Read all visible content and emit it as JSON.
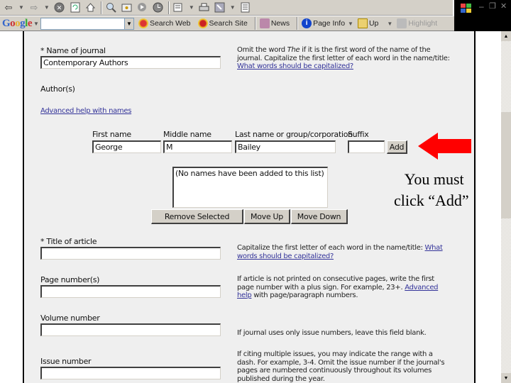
{
  "browser": {
    "toolbar_icons": [
      "back-icon",
      "forward-icon",
      "stop-icon",
      "refresh-icon",
      "home-icon",
      "search-icon",
      "favorites-icon",
      "media-icon",
      "history-icon",
      "mail-icon",
      "print-icon",
      "edit-icon",
      "discuss-icon"
    ],
    "google_bar": {
      "logo": "Google",
      "search_value": "",
      "buttons": {
        "search_web": "Search Web",
        "search_site": "Search Site",
        "news": "News",
        "page_info": "Page Info",
        "up": "Up",
        "highlight": "Highlight"
      }
    },
    "window_controls": {
      "minimize": "–",
      "restore": "❐",
      "close": "✕"
    }
  },
  "form": {
    "journal": {
      "label": "* Name of journal",
      "value": "Contemporary Authors",
      "help_prefix": "Omit the word ",
      "help_italic": "The",
      "help_suffix": " if it is the first word of the name of the journal. Capitalize the first letter of each word in the name/title: ",
      "help_link": "What words should be capitalized?"
    },
    "authors": {
      "label": "Author(s)",
      "help_link": "Advanced help with names",
      "columns": {
        "first": "First name",
        "middle": "Middle name",
        "last": "Last name or group/corporation",
        "suffix": "Suffix"
      },
      "values": {
        "first": "George",
        "middle": "M",
        "last": "Bailey",
        "suffix": ""
      },
      "add_button": "Add",
      "list_placeholder": "(No names have been added to this list)",
      "remove_button": "Remove Selected",
      "move_up_button": "Move Up",
      "move_down_button": "Move Down"
    },
    "title": {
      "label": "* Title of article",
      "value": "",
      "help_text": "Capitalize the first letter of each word in the name/title: ",
      "help_link": "What words should be capitalized?"
    },
    "pages": {
      "label": "Page number(s)",
      "value": "",
      "help_text": "If article is not printed on consecutive pages, write the first page number with a plus sign. For example, 23+. ",
      "help_link": "Advanced help",
      "help_suffix": " with page/paragraph numbers."
    },
    "volume": {
      "label": "Volume number",
      "value": "",
      "help_text": "If journal uses only issue numbers, leave this field blank."
    },
    "issue": {
      "label": "Issue number",
      "value": "",
      "help_text": "If citing multiple issues, you may indicate the range with a dash. For example, 3-4. Omit the issue number if the journal's pages are numbered continuously throughout its volumes published during the year."
    }
  },
  "annotation": {
    "line1": "You must",
    "line2": "click “Add”",
    "arrow_color": "#ff0000"
  }
}
